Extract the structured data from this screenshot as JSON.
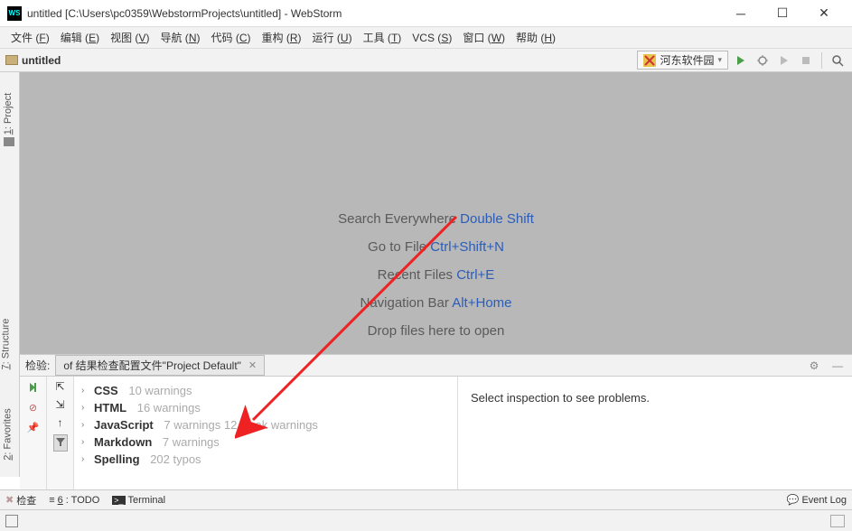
{
  "titlebar": {
    "icon_text": "WS",
    "title": "untitled [C:\\Users\\pc0359\\WebstormProjects\\untitled] - WebStorm"
  },
  "menubar": {
    "items": [
      {
        "label": "文件",
        "key": "F"
      },
      {
        "label": "编辑",
        "key": "E"
      },
      {
        "label": "视图",
        "key": "V"
      },
      {
        "label": "导航",
        "key": "N"
      },
      {
        "label": "代码",
        "key": "C"
      },
      {
        "label": "重构",
        "key": "R"
      },
      {
        "label": "运行",
        "key": "U"
      },
      {
        "label": "工具",
        "key": "T"
      },
      {
        "label": "VCS",
        "key": "S"
      },
      {
        "label": "窗口",
        "key": "W"
      },
      {
        "label": "帮助",
        "key": "H"
      }
    ]
  },
  "toolbar": {
    "project_name": "untitled",
    "run_config": "河东软件园"
  },
  "left_tabs": {
    "project": "1: Project",
    "structure": "7: Structure",
    "favorites": "2: Favorites"
  },
  "placeholder": {
    "l1a": "Search Everywhere ",
    "l1b": "Double Shift",
    "l2a": "Go to File ",
    "l2b": "Ctrl+Shift+N",
    "l3a": "Recent Files ",
    "l3b": "Ctrl+E",
    "l4a": "Navigation Bar ",
    "l4b": "Alt+Home",
    "l5": "Drop files here to open"
  },
  "inspect": {
    "header_label": "检验:",
    "tab_label": "of 结果检查配置文件\"Project Default\"",
    "rows": [
      {
        "cat": "CSS",
        "cnt": "10 warnings"
      },
      {
        "cat": "HTML",
        "cnt": "16 warnings"
      },
      {
        "cat": "JavaScript",
        "cnt": "7 warnings 12 weak warnings"
      },
      {
        "cat": "Markdown",
        "cnt": "7 warnings"
      },
      {
        "cat": "Spelling",
        "cnt": "202 typos"
      }
    ],
    "detail": "Select inspection to see problems."
  },
  "bottom_tabs": {
    "inspect": "检查",
    "todo": "6: TODO",
    "terminal": "Terminal",
    "eventlog": "Event Log"
  }
}
